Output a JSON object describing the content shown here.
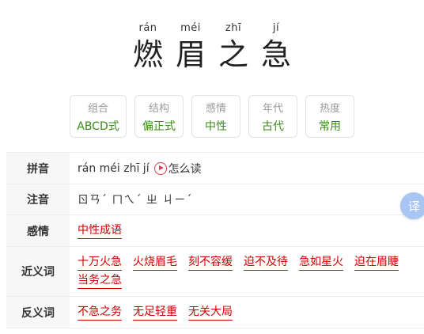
{
  "idiom": {
    "chars": [
      {
        "pinyin": "rán",
        "hanzi": "燃"
      },
      {
        "pinyin": "méi",
        "hanzi": "眉"
      },
      {
        "pinyin": "zhī",
        "hanzi": "之"
      },
      {
        "pinyin": "jí",
        "hanzi": "急"
      }
    ]
  },
  "tags": [
    {
      "label": "组合",
      "value": "ABCD式"
    },
    {
      "label": "结构",
      "value": "偏正式"
    },
    {
      "label": "感情",
      "value": "中性"
    },
    {
      "label": "年代",
      "value": "古代"
    },
    {
      "label": "热度",
      "value": "常用"
    }
  ],
  "table": {
    "pinyin_label": "拼音",
    "pinyin_value": "rán méi zhī jí",
    "how_to_read": "怎么读",
    "zhuyin_label": "注音",
    "zhuyin_value": "ㄖㄢˊ ㄇㄟˊ ㄓ ㄐㄧˊ",
    "emotion_label": "感情",
    "emotion_value": "中性成语",
    "synonyms_label": "近义词",
    "synonyms": [
      "十万火急",
      "火烧眉毛",
      "刻不容缓",
      "迫不及待",
      "急如星火",
      "迫在眉睫",
      "当务之急"
    ],
    "antonyms_label": "反义词",
    "antonyms": [
      "不急之务",
      "无足轻重",
      "无关大局"
    ]
  },
  "translate_button": "译",
  "colors": {
    "tag_value": "#3a8a17",
    "link": "#cc0000",
    "play_icon": "#e0364a",
    "translate_button": "#a9c5f3"
  }
}
